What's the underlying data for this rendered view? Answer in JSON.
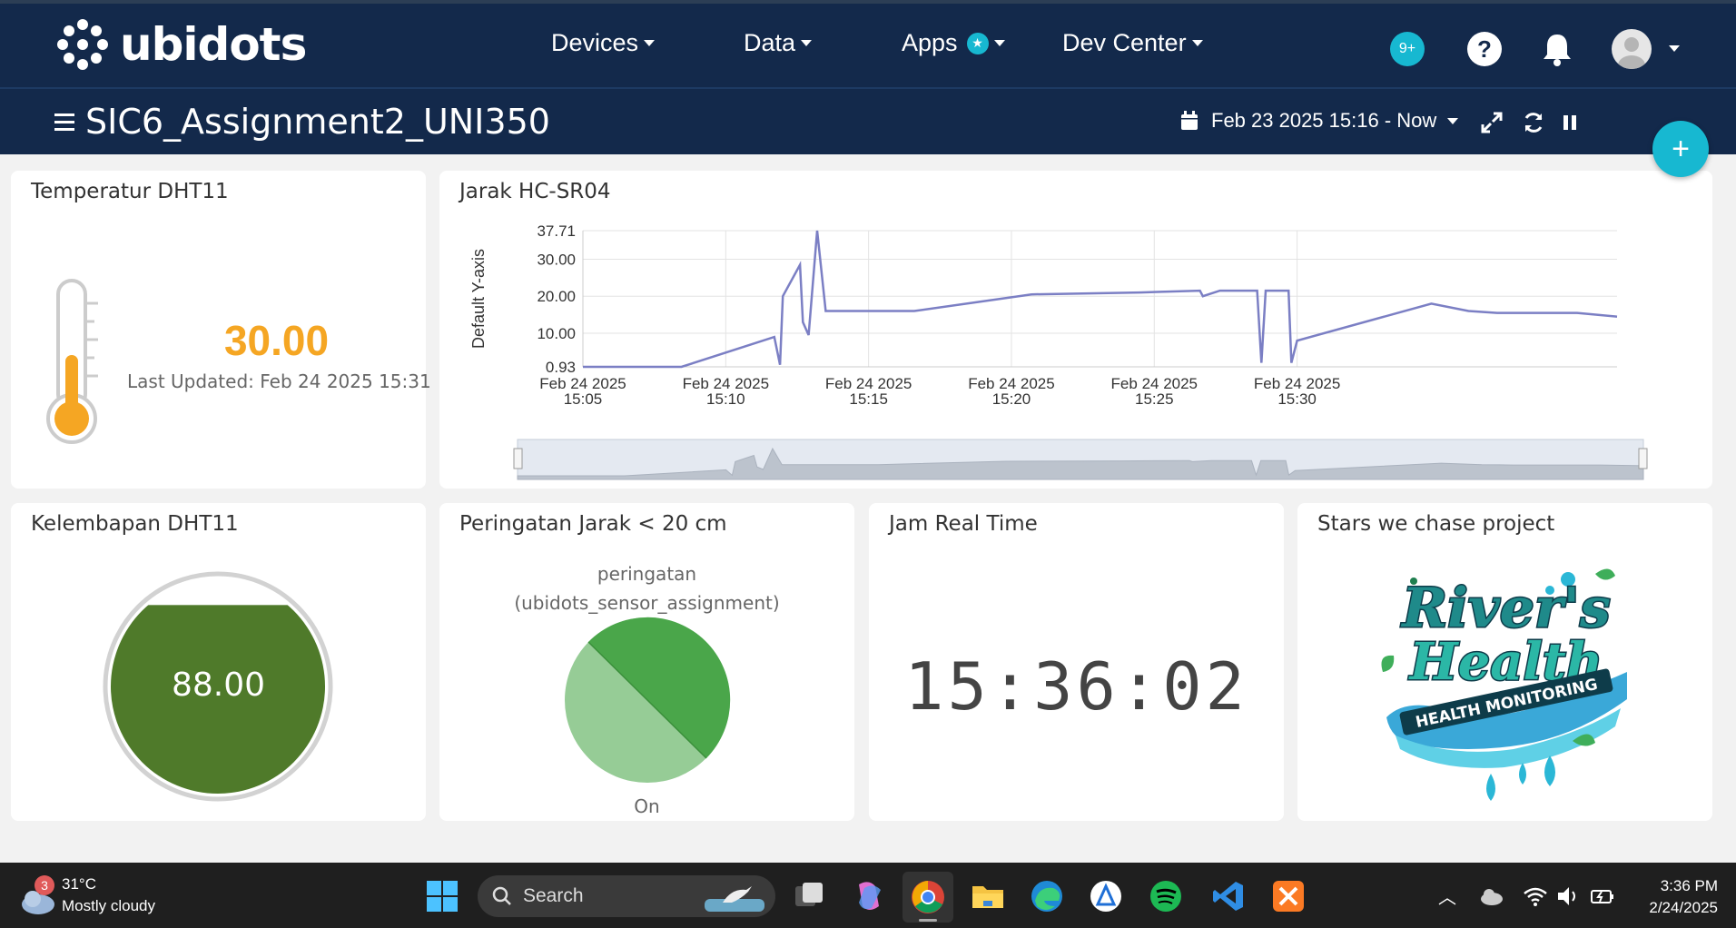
{
  "app": {
    "logo_text": "ubidots"
  },
  "nav": {
    "devices": "Devices",
    "data": "Data",
    "apps": "Apps",
    "dev_center": "Dev Center",
    "notifications_count": "9+"
  },
  "dashboard": {
    "title": "SIC6_Assignment2_UNI350",
    "date_range": "Feb 23 2025 15:16 - Now"
  },
  "widgets": {
    "temperature": {
      "title": "Temperatur DHT11",
      "value": "30.00",
      "last_updated": "Last Updated: Feb 24 2025 15:31",
      "thermometer_fill": 0.45,
      "color": "#f5a623"
    },
    "distance_chart": {
      "title": "Jarak HC-SR04",
      "ylabel": "Default Y-axis"
    },
    "humidity": {
      "title": "Kelembapan DHT11",
      "value": "88.00",
      "fill_color": "#4f7a2a",
      "level": 0.88
    },
    "warning": {
      "title": "Peringatan Jarak < 20 cm",
      "label_line1": "peringatan",
      "label_line2": "(ubidots_sensor_assignment)",
      "state": "On"
    },
    "clock": {
      "title": "Jam Real Time",
      "time": "15:36:02"
    },
    "project": {
      "title": "Stars we chase project",
      "logo_line1": "River's",
      "logo_line2": "Health",
      "logo_line3": "HEALTH MONITORING"
    }
  },
  "chart_data": {
    "type": "line",
    "title": "Jarak HC-SR04",
    "xlabel": "",
    "ylabel": "Default Y-axis",
    "ylim": [
      0.93,
      37.71
    ],
    "yticks": [
      "37.71",
      "30.00",
      "20.00",
      "10.00",
      "0.93"
    ],
    "xticks": [
      [
        "Feb 24 2025",
        "15:05"
      ],
      [
        "Feb 24 2025",
        "15:10"
      ],
      [
        "Feb 24 2025",
        "15:15"
      ],
      [
        "Feb 24 2025",
        "15:20"
      ],
      [
        "Feb 24 2025",
        "15:25"
      ],
      [
        "Feb 24 2025",
        "15:30"
      ]
    ],
    "x_minutes_range": [
      15.0,
      31.2
    ],
    "series": [
      {
        "color": "#7b7fc4",
        "points": [
          [
            15.0,
            0.93
          ],
          [
            18.45,
            0.93
          ],
          [
            21.7,
            9.0
          ],
          [
            21.9,
            1.5
          ],
          [
            22.0,
            20.0
          ],
          [
            22.6,
            28.5
          ],
          [
            22.7,
            13.0
          ],
          [
            22.9,
            9.5
          ],
          [
            23.2,
            37.71
          ],
          [
            23.5,
            16.0
          ],
          [
            25.0,
            16.0
          ],
          [
            26.6,
            16.0
          ],
          [
            30.7,
            20.5
          ],
          [
            34.5,
            21.0
          ],
          [
            36.6,
            21.5
          ],
          [
            36.7,
            20.0
          ],
          [
            37.3,
            21.5
          ],
          [
            38.6,
            21.5
          ],
          [
            38.75,
            2.0
          ],
          [
            38.9,
            21.5
          ],
          [
            39.7,
            21.5
          ],
          [
            39.8,
            2.0
          ],
          [
            40.0,
            8.0
          ],
          [
            44.7,
            18.0
          ],
          [
            46.0,
            16.0
          ],
          [
            47.0,
            15.5
          ],
          [
            49.8,
            15.5
          ],
          [
            51.2,
            14.5
          ]
        ]
      }
    ],
    "grid": true
  },
  "taskbar": {
    "weather_temp": "31°C",
    "weather_desc": "Mostly cloudy",
    "weather_badge": "3",
    "search": "Search",
    "time": "3:36 PM",
    "date": "2/24/2025"
  }
}
